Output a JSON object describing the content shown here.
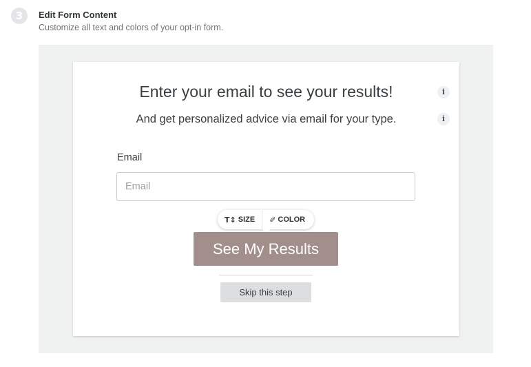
{
  "step": {
    "number": "3",
    "title": "Edit Form Content",
    "subtitle": "Customize all text and colors of your opt-in form."
  },
  "form": {
    "headline": "Enter your email to see your results!",
    "subheadline": "And get personalized advice via email for your type.",
    "info_icon": "i",
    "email_label": "Email",
    "email_placeholder": "Email",
    "email_value": "",
    "toolbar": {
      "size_icon": "T↕",
      "size_label": "SIZE",
      "color_icon": "✐",
      "color_label": "COLOR"
    },
    "cta_label": "See My Results",
    "skip_label": "Skip this step"
  },
  "colors": {
    "cta_background": "#a28f8b",
    "preview_background": "#f0f2f2",
    "skip_background": "#dddedf"
  }
}
